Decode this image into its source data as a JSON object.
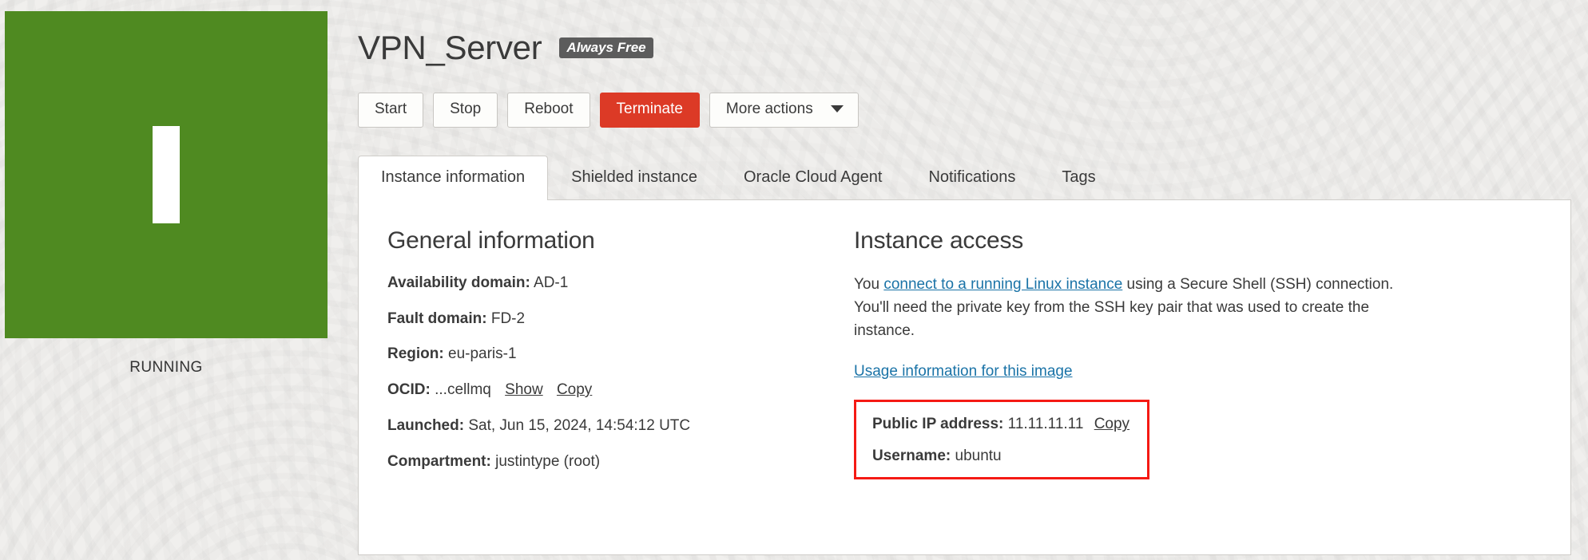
{
  "status_panel": {
    "state_label": "RUNNING",
    "state_color": "#4f8a21",
    "glyph": "power-bar-icon"
  },
  "header": {
    "title": "VPN_Server",
    "badge": "Always Free"
  },
  "actions": {
    "start": "Start",
    "stop": "Stop",
    "reboot": "Reboot",
    "terminate": "Terminate",
    "more_actions": "More actions"
  },
  "tabs": [
    {
      "label": "Instance information",
      "active": true
    },
    {
      "label": "Shielded instance",
      "active": false
    },
    {
      "label": "Oracle Cloud Agent",
      "active": false
    },
    {
      "label": "Notifications",
      "active": false
    },
    {
      "label": "Tags",
      "active": false
    }
  ],
  "general_information": {
    "heading": "General information",
    "rows": [
      {
        "key": "Availability domain:",
        "value": "AD-1"
      },
      {
        "key": "Fault domain:",
        "value": "FD-2"
      },
      {
        "key": "Region:",
        "value": "eu-paris-1"
      },
      {
        "key": "OCID:",
        "value": "...cellmq",
        "link_show": "Show",
        "link_copy": "Copy"
      },
      {
        "key": "Launched:",
        "value": "Sat, Jun 15, 2024, 14:54:12 UTC"
      },
      {
        "key": "Compartment:",
        "value": "justintype (root)"
      }
    ]
  },
  "instance_access": {
    "heading": "Instance access",
    "para_pre": "You ",
    "para_link": "connect to a running Linux instance",
    "para_post": " using a Secure Shell (SSH) connection. You'll need the private key from the SSH key pair that was used to create the instance.",
    "usage_link": "Usage information for this image",
    "highlight_color": "#f51a14",
    "public_ip_key": "Public IP address:",
    "public_ip_value": "11.11.11.11",
    "public_ip_copy": "Copy",
    "username_key": "Username:",
    "username_value": "ubuntu"
  }
}
